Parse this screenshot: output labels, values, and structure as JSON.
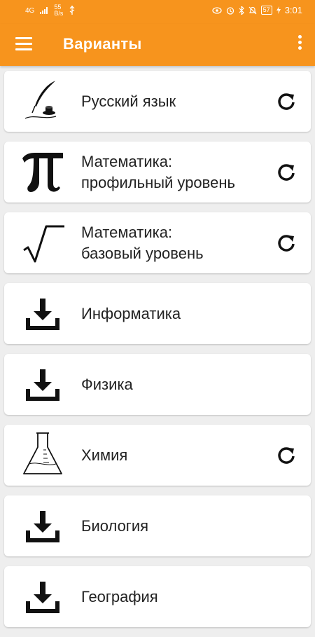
{
  "status_bar": {
    "signal": "4G",
    "speed_value": "55",
    "speed_unit": "B/s",
    "battery": "57",
    "time": "3:01"
  },
  "app_bar": {
    "title": "Варианты"
  },
  "subjects": [
    {
      "label": "Русский язык",
      "icon": "quill-inkwell-icon",
      "action": "refresh-icon"
    },
    {
      "label": "Математика:\nпрофильный уровень",
      "icon": "pi-icon",
      "action": "refresh-icon"
    },
    {
      "label": "Математика:\nбазовый уровень",
      "icon": "square-root-icon",
      "action": "refresh-icon"
    },
    {
      "label": "Информатика",
      "icon": "download-icon",
      "action": null
    },
    {
      "label": "Физика",
      "icon": "download-icon",
      "action": null
    },
    {
      "label": "Химия",
      "icon": "flask-icon",
      "action": "refresh-icon"
    },
    {
      "label": "Биология",
      "icon": "download-icon",
      "action": null
    },
    {
      "label": "География",
      "icon": "download-icon",
      "action": null
    }
  ],
  "colors": {
    "accent": "#f7941d",
    "background": "#eeeeee",
    "card": "#ffffff",
    "text": "#222222"
  }
}
